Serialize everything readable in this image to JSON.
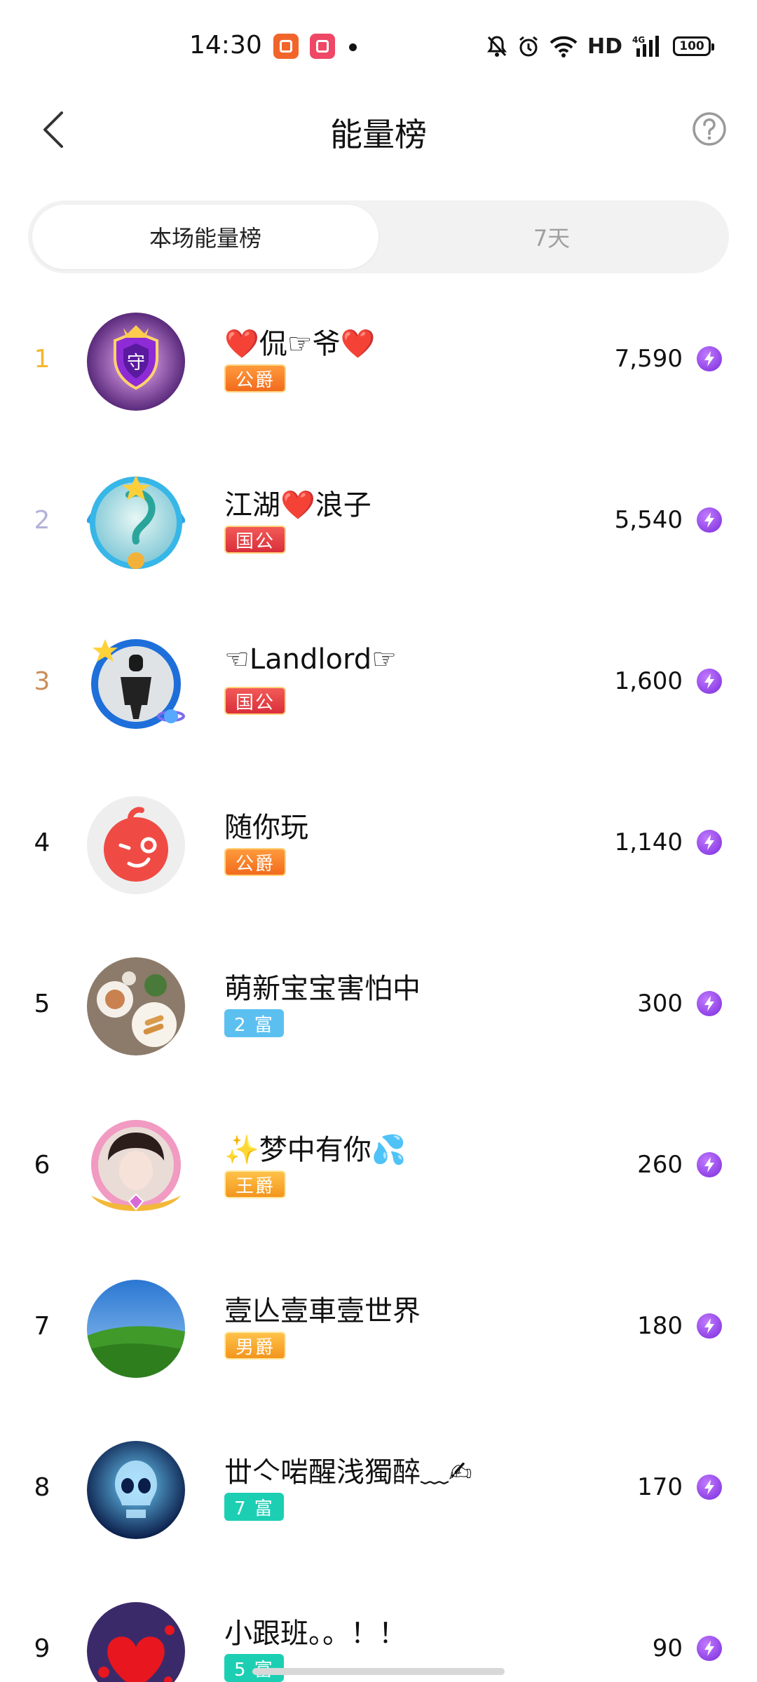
{
  "status_bar": {
    "time": "14:30",
    "hd": "HD",
    "network": "4G",
    "battery": "100"
  },
  "header": {
    "title": "能量榜"
  },
  "tabs": [
    {
      "label": "本场能量榜",
      "active": true
    },
    {
      "label": "7天",
      "active": false
    }
  ],
  "rows": [
    {
      "rank": "1",
      "name": "❤️侃☞爷❤️",
      "badge": "公爵",
      "badge_color": "#f26b1d",
      "score": "7,590"
    },
    {
      "rank": "2",
      "name": "江湖❤️浪子",
      "badge": "国公",
      "badge_color": "#d92f3a",
      "score": "5,540"
    },
    {
      "rank": "3",
      "name": "☜Landlord☞",
      "badge": "国公",
      "badge_color": "#d92f3a",
      "score": "1,600"
    },
    {
      "rank": "4",
      "name": "随你玩",
      "badge": "公爵",
      "badge_color": "#f26b1d",
      "score": "1,140"
    },
    {
      "rank": "5",
      "name": "萌新宝宝害怕中",
      "badge": "2 富",
      "badge_color": "#5bc0f0",
      "score": "300"
    },
    {
      "rank": "6",
      "name": "✨梦中有你💦",
      "badge": "王爵",
      "badge_color": "#f3951d",
      "score": "260"
    },
    {
      "rank": "7",
      "name": "壹亾壹車壹世界",
      "badge": "男爵",
      "badge_color": "#f3951d",
      "score": "180"
    },
    {
      "rank": "8",
      "name": "丗亽啱醒浅獨醉﹏✍",
      "badge": "7 富",
      "badge_color": "#1ccfb3",
      "score": "170"
    },
    {
      "rank": "9",
      "name": "小跟班。。！！",
      "badge": "5 富",
      "badge_color": "#1ccfb3",
      "score": "90"
    }
  ],
  "icons": {
    "back": "chevron-left-icon",
    "help": "question-circle-icon",
    "energy": "lightning-bolt-icon"
  }
}
